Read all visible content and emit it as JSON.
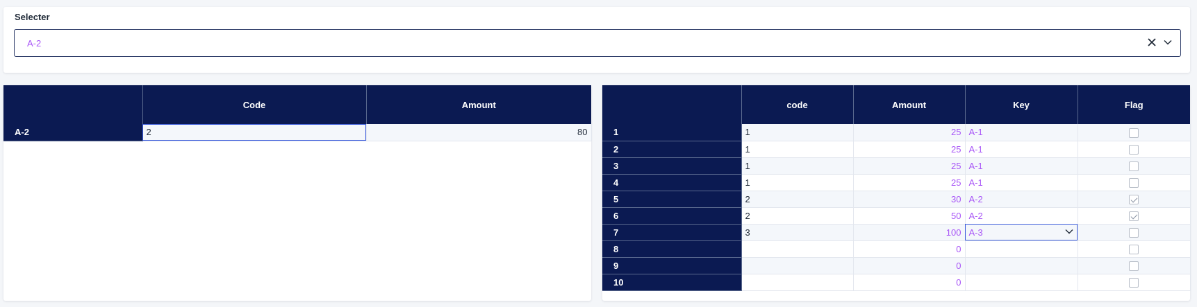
{
  "selector": {
    "label": "Selecter",
    "value": "A-2"
  },
  "left_table": {
    "headers": [
      "",
      "Code",
      "Amount"
    ],
    "rows": [
      {
        "label": "A-2",
        "code": "2",
        "amount": "80"
      }
    ]
  },
  "right_table": {
    "headers": [
      "",
      "code",
      "Amount",
      "Key",
      "Flag"
    ],
    "rows": [
      {
        "label": "1",
        "code": "1",
        "amount": "25",
        "key": "A-1",
        "flag": false
      },
      {
        "label": "2",
        "code": "1",
        "amount": "25",
        "key": "A-1",
        "flag": false
      },
      {
        "label": "3",
        "code": "1",
        "amount": "25",
        "key": "A-1",
        "flag": false
      },
      {
        "label": "4",
        "code": "1",
        "amount": "25",
        "key": "A-1",
        "flag": false
      },
      {
        "label": "5",
        "code": "2",
        "amount": "30",
        "key": "A-2",
        "flag": true
      },
      {
        "label": "6",
        "code": "2",
        "amount": "50",
        "key": "A-2",
        "flag": true
      },
      {
        "label": "7",
        "code": "3",
        "amount": "100",
        "key": "A-3",
        "flag": false
      },
      {
        "label": "8",
        "code": "",
        "amount": "0",
        "key": "",
        "flag": false
      },
      {
        "label": "9",
        "code": "",
        "amount": "0",
        "key": "",
        "flag": false
      },
      {
        "label": "10",
        "code": "",
        "amount": "0",
        "key": "",
        "flag": false
      }
    ]
  },
  "colors": {
    "header_bg": "#0b1a52",
    "accent_text": "#a855f7",
    "selection_border": "#3b5bdb"
  },
  "icons": {
    "clear": "close-icon",
    "dropdown": "chevron-down-icon",
    "checkbox": "checkbox-icon"
  }
}
